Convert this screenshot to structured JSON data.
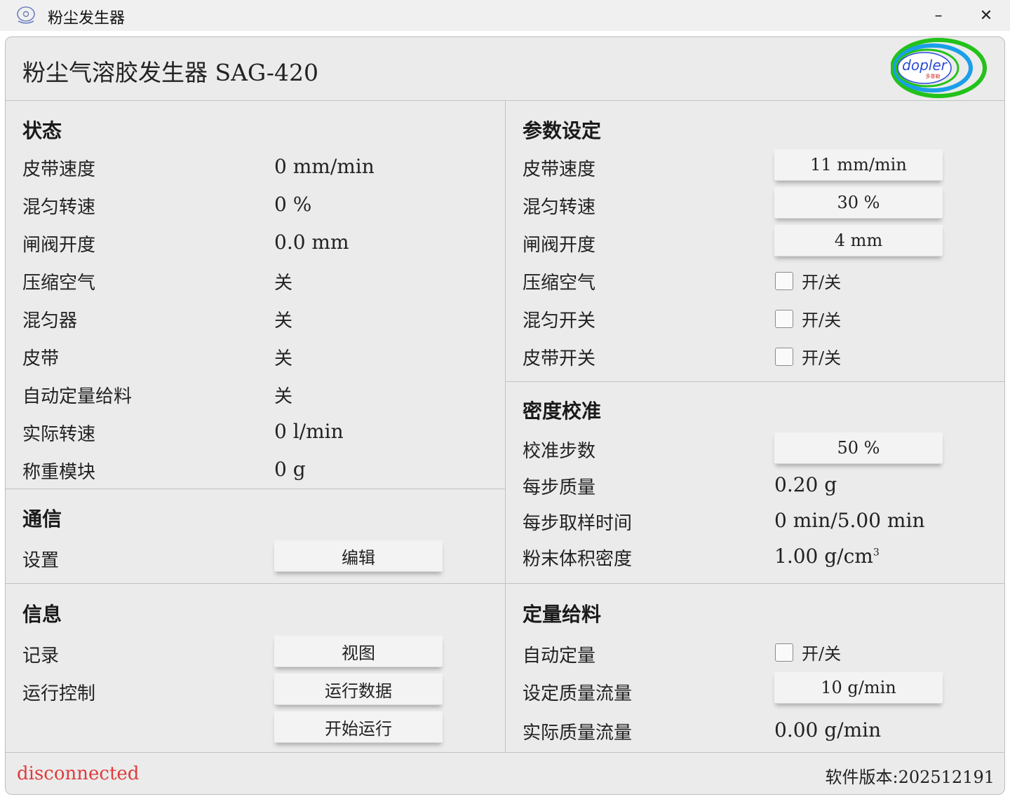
{
  "window": {
    "title": "粉尘发生器",
    "minimize_glyph": "–",
    "close_glyph": "✕",
    "icon": "device-icon"
  },
  "header": {
    "title": "粉尘气溶胶发生器 SAG-420",
    "logo_text": "dopler",
    "logo_subtext": "多普勒",
    "logo_colors": [
      "#1a9fe8",
      "#23c21a",
      "#2a4bd6"
    ]
  },
  "status": {
    "title": "状态",
    "rows": [
      {
        "label": "皮带速度",
        "value": "0 mm/min"
      },
      {
        "label": "混匀转速",
        "value": "0 %"
      },
      {
        "label": "闸阀开度",
        "value": "0.0 mm"
      },
      {
        "label": "压缩空气",
        "value": "关"
      },
      {
        "label": "混匀器",
        "value": "关"
      },
      {
        "label": "皮带",
        "value": "关"
      },
      {
        "label": "自动定量给料",
        "value": "关"
      },
      {
        "label": "实际转速",
        "value": "0 l/min"
      },
      {
        "label": "称重模块",
        "value": "0 g"
      }
    ]
  },
  "comm": {
    "title": "通信",
    "settings_label": "设置",
    "edit_button": "编辑"
  },
  "info": {
    "title": "信息",
    "record_label": "记录",
    "view_button": "视图",
    "run_label": "运行控制",
    "run_data_button": "运行数据",
    "start_button": "开始运行"
  },
  "params": {
    "title": "参数设定",
    "belt_speed_label": "皮带速度",
    "belt_speed_value": "11 mm/min",
    "mix_speed_label": "混匀转速",
    "mix_speed_value": "30 %",
    "valve_label": "闸阀开度",
    "valve_value": "4 mm",
    "air_label": "压缩空气",
    "air_toggle": "开/关",
    "mixer_label": "混匀开关",
    "mixer_toggle": "开/关",
    "belt_label": "皮带开关",
    "belt_toggle": "开/关"
  },
  "density": {
    "title": "密度校准",
    "steps_label": "校准步数",
    "steps_value": "50 %",
    "mass_label": "每步质量",
    "mass_value": "0.20 g",
    "time_label": "每步取样时间",
    "time_value": "0 min/5.00 min",
    "bulk_label": "粉末体积密度",
    "bulk_value": "1.00 g/cm",
    "bulk_exp": "3"
  },
  "dosing": {
    "title": "定量给料",
    "auto_label": "自动定量",
    "auto_toggle": "开/关",
    "set_flow_label": "设定质量流量",
    "set_flow_value": "10 g/min",
    "actual_flow_label": "实际质量流量",
    "actual_flow_value": "0.00 g/min"
  },
  "footer": {
    "status": "disconnected",
    "status_color": "#e03b3b",
    "version": "软件版本:202512191"
  }
}
